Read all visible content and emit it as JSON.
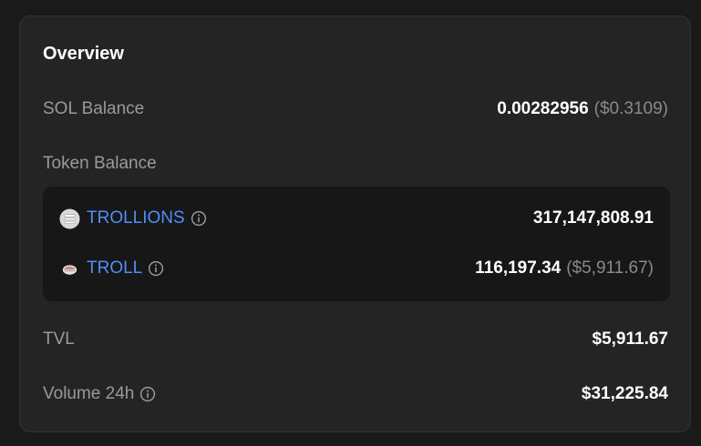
{
  "overview": {
    "title": "Overview",
    "sol_balance": {
      "label": "SOL Balance",
      "amount": "0.00282956",
      "usd": "($0.3109)"
    },
    "token_balance": {
      "label": "Token Balance",
      "tokens": [
        {
          "name": "TROLLIONS",
          "amount": "317,147,808.91",
          "usd": "",
          "icon": "trollions-token-icon"
        },
        {
          "name": "TROLL",
          "amount": "116,197.34",
          "usd": "($5,911.67)",
          "icon": "troll-token-icon"
        }
      ]
    },
    "tvl": {
      "label": "TVL",
      "value": "$5,911.67"
    },
    "volume": {
      "label": "Volume 24h",
      "value": "$31,225.84"
    }
  },
  "colors": {
    "background": "#1a1a1a",
    "card": "#242424",
    "token_box": "#171717",
    "link": "#4f8ff7",
    "label": "#9a9a9a",
    "value": "#ffffff"
  },
  "icons": [
    "info-icon",
    "trollions-token-icon",
    "troll-token-icon"
  ]
}
